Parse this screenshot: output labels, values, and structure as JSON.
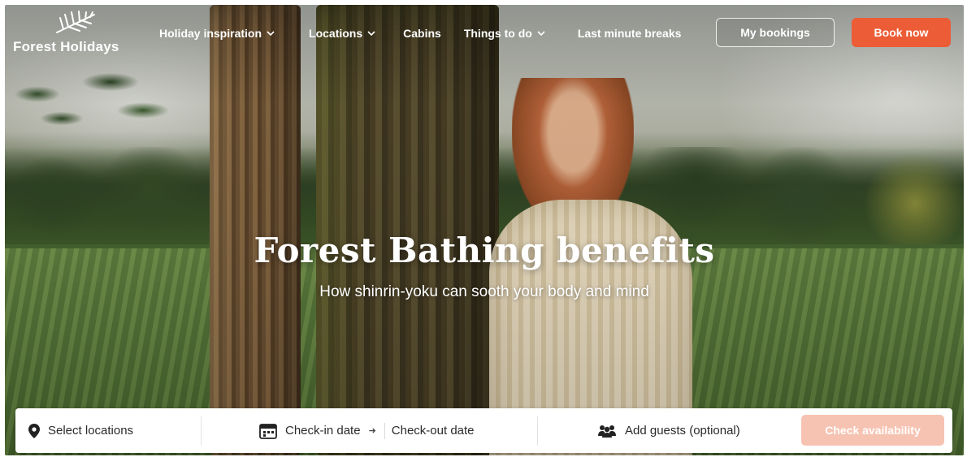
{
  "brand": {
    "name": "Forest Holidays"
  },
  "nav": {
    "items": [
      {
        "label": "Holiday inspiration",
        "has_dropdown": true
      },
      {
        "label": "Locations",
        "has_dropdown": true
      },
      {
        "label": "Cabins",
        "has_dropdown": false
      },
      {
        "label": "Things to do",
        "has_dropdown": true
      },
      {
        "label": "Last minute breaks",
        "has_dropdown": false
      }
    ],
    "my_bookings_label": "My bookings",
    "book_now_label": "Book now"
  },
  "hero": {
    "title": "Forest Bathing benefits",
    "subtitle": "How shinrin-yoku can sooth your body and mind"
  },
  "search": {
    "location_label": "Select locations",
    "checkin_label": "Check-in date",
    "checkout_label": "Check-out date",
    "guests_label": "Add guests (optional)",
    "submit_label": "Check availability"
  },
  "icons": {
    "logo": "fern-leaf-icon",
    "dropdown": "chevron-down-icon",
    "location": "map-pin-icon",
    "calendar": "calendar-icon",
    "date_arrow": "arrow-right-icon",
    "guests": "people-icon"
  },
  "colors": {
    "accent": "#ec5c36",
    "accent_disabled": "#f6c3b2",
    "text_light": "#ffffff",
    "text_dark": "#2a2a2a"
  }
}
